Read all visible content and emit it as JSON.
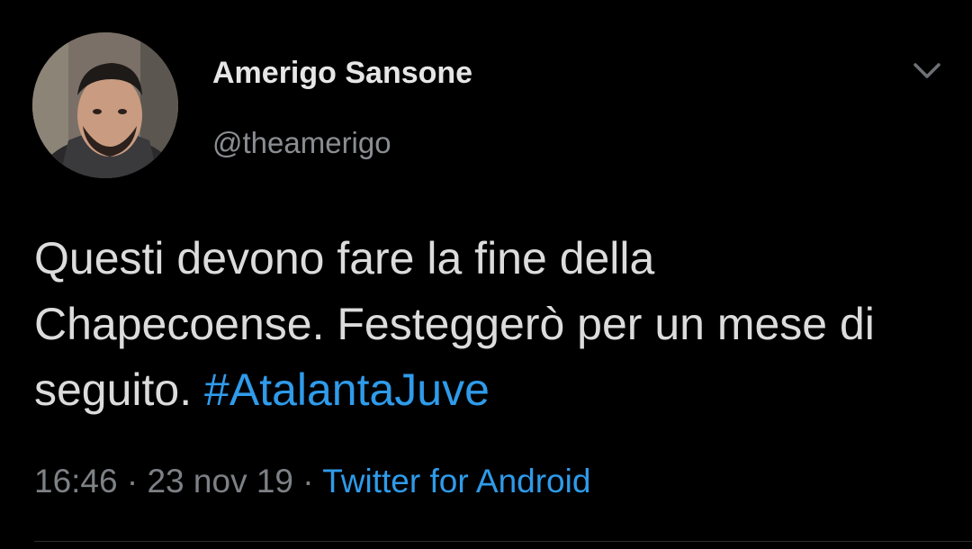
{
  "author": {
    "display_name": "Amerigo Sansone",
    "handle": "@theamerigo"
  },
  "tweet": {
    "text": "Questi devono fare la fine della Chapecoense. Festeggerò per un mese di seguito.",
    "hashtag": "#AtalantaJuve"
  },
  "meta": {
    "time": "16:46",
    "separator_1": " · ",
    "date": "23 nov 19",
    "separator_2": " · ",
    "source": "Twitter for Android"
  },
  "icons": {
    "menu": "chevron-down-icon"
  },
  "colors": {
    "background": "#000000",
    "link": "#2f9bea",
    "muted": "#7d8185",
    "text": "#dcdcdc"
  }
}
